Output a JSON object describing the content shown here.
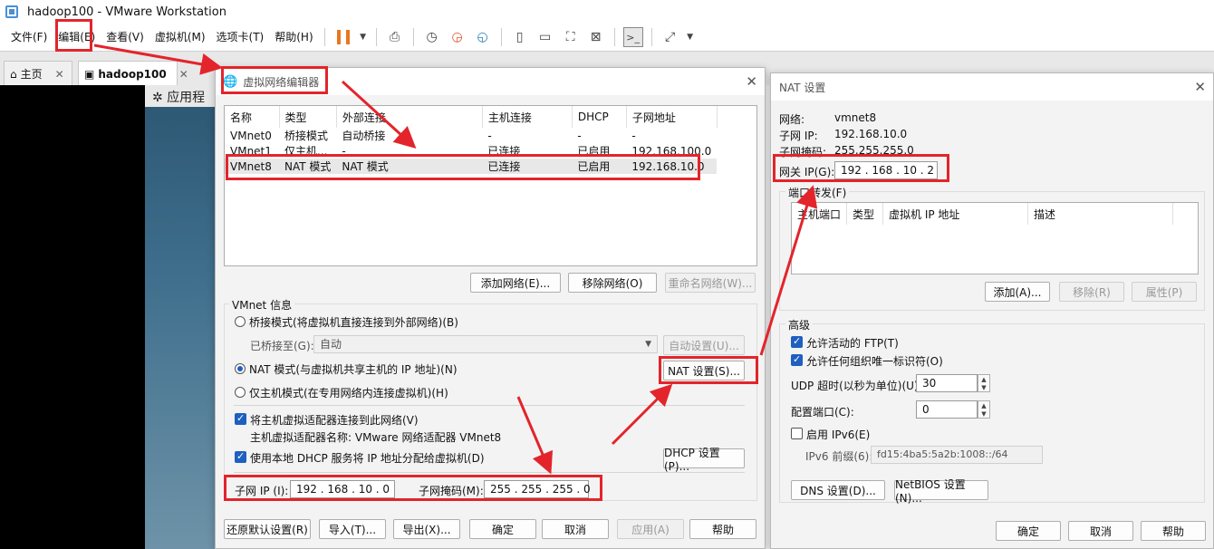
{
  "window": {
    "title": "hadoop100 - VMware Workstation"
  },
  "menu": [
    "文件(F)",
    "编辑(E)",
    "查看(V)",
    "虚拟机(M)",
    "选项卡(T)",
    "帮助(H)"
  ],
  "tabs": [
    {
      "label": "主页"
    },
    {
      "label": "hadoop100"
    }
  ],
  "guest": {
    "apps_label": "应用程"
  },
  "vne": {
    "title": "虚拟网络编辑器",
    "columns": [
      "名称",
      "类型",
      "外部连接",
      "主机连接",
      "DHCP",
      "子网地址"
    ],
    "rows": [
      [
        "VMnet0",
        "桥接模式",
        "自动桥接",
        "-",
        "-",
        "-"
      ],
      [
        "VMnet1",
        "仅主机...",
        "-",
        "已连接",
        "已启用",
        "192.168.100.0"
      ],
      [
        "VMnet8",
        "NAT 模式",
        "NAT 模式",
        "已连接",
        "已启用",
        "192.168.10.0"
      ]
    ],
    "add_network": "添加网络(E)...",
    "remove_network": "移除网络(O)",
    "rename_network": "重命名网络(W)...",
    "vmnet_info": "VMnet 信息",
    "bridged_mode": "桥接模式(将虚拟机直接连接到外部网络)(B)",
    "bridged_to_label": "已桥接至(G):",
    "bridged_to_value": "自动",
    "auto_settings": "自动设置(U)...",
    "nat_mode": "NAT 模式(与虚拟机共享主机的 IP 地址)(N)",
    "nat_settings": "NAT 设置(S)...",
    "host_only": "仅主机模式(在专用网络内连接虚拟机)(H)",
    "connect_adapter": "将主机虚拟适配器连接到此网络(V)",
    "adapter_name": "主机虚拟适配器名称: VMware 网络适配器 VMnet8",
    "use_dhcp": "使用本地 DHCP 服务将 IP 地址分配给虚拟机(D)",
    "dhcp_settings": "DHCP 设置(P)...",
    "subnet_ip_label": "子网 IP (I):",
    "subnet_ip": "192 . 168 . 10 . 0",
    "subnet_mask_label": "子网掩码(M):",
    "subnet_mask": "255 . 255 . 255 . 0",
    "restore": "还原默认设置(R)",
    "import": "导入(T)...",
    "export": "导出(X)...",
    "ok": "确定",
    "cancel": "取消",
    "apply": "应用(A)",
    "help": "帮助"
  },
  "nat": {
    "title": "NAT 设置",
    "network_label": "网络:",
    "network_value": "vmnet8",
    "subnet_ip_label": "子网 IP:",
    "subnet_ip_value": "192.168.10.0",
    "subnet_mask_label": "子网掩码:",
    "subnet_mask_value": "255.255.255.0",
    "gateway_label": "网关 IP(G):",
    "gateway_value": "192 . 168 . 10 . 2",
    "port_forwarding": "端口转发(F)",
    "pf_columns": [
      "主机端口",
      "类型",
      "虚拟机 IP 地址",
      "描述"
    ],
    "add": "添加(A)...",
    "remove": "移除(R)",
    "properties": "属性(P)",
    "advanced": "高级",
    "allow_ftp": "允许活动的 FTP(T)",
    "allow_oui": "允许任何组织唯一标识符(O)",
    "udp_timeout_label": "UDP 超时(以秒为单位)(U):",
    "udp_timeout_value": "30",
    "config_port_label": "配置端口(C):",
    "config_port_value": "0",
    "enable_ipv6": "启用 IPv6(E)",
    "ipv6_prefix_label": "IPv6 前缀(6):",
    "ipv6_prefix_value": "fd15:4ba5:5a2b:1008::/64",
    "dns_settings": "DNS 设置(D)...",
    "netbios_settings": "NetBIOS 设置(N)...",
    "ok": "确定",
    "cancel": "取消",
    "help": "帮助"
  },
  "colors": {
    "annotation_red": "#e3242b",
    "accent_blue": "#1f5fbf",
    "pause_orange": "#e87722"
  }
}
